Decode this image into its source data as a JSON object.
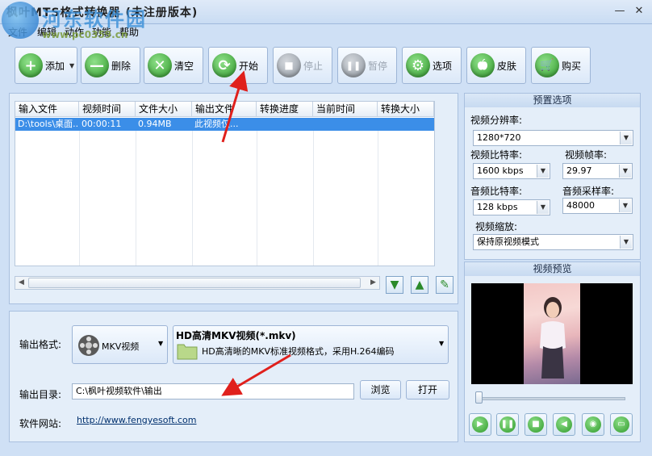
{
  "window": {
    "title": "枫叶MTS格式转换器  (未注册版本)",
    "minimize_glyph": "—",
    "close_glyph": "✕"
  },
  "watermark": {
    "site_name": "河东软件园",
    "url": "www.pc0359.cn"
  },
  "menu": [
    "文件",
    "编辑",
    "动作",
    "功能",
    "帮助"
  ],
  "toolbar": [
    {
      "label": "添加",
      "icon": "plus-icon",
      "glyph": "+",
      "enabled": true,
      "dropdown": true
    },
    {
      "label": "删除",
      "icon": "minus-icon",
      "glyph": "—",
      "enabled": true
    },
    {
      "label": "清空",
      "icon": "clear-icon",
      "glyph": "✕",
      "enabled": true
    },
    {
      "label": "开始",
      "icon": "start-icon",
      "glyph": "⟳",
      "enabled": true
    },
    {
      "label": "停止",
      "icon": "stop-icon",
      "glyph": "■",
      "enabled": false
    },
    {
      "label": "暂停",
      "icon": "pause-icon",
      "glyph": "❚❚",
      "enabled": false
    },
    {
      "label": "选项",
      "icon": "options-icon",
      "glyph": "⚙",
      "enabled": true
    },
    {
      "label": "皮肤",
      "icon": "skin-icon",
      "glyph": "",
      "enabled": true
    },
    {
      "label": "购买",
      "icon": "cart-icon",
      "glyph": "🛒",
      "enabled": true
    }
  ],
  "file_list": {
    "columns": [
      "输入文件",
      "视频时间",
      "文件大小",
      "输出文件",
      "转换进度",
      "当前时间",
      "转换大小"
    ],
    "rows": [
      {
        "input": "D:\\tools\\桌面...",
        "duration": "00:00:11",
        "size": "0.94MB",
        "output": "此视频仅...",
        "progress": "",
        "current": "",
        "converted": ""
      }
    ]
  },
  "list_actions": {
    "down": "▼",
    "up": "▲",
    "edit": "✎"
  },
  "preset": {
    "title": "预置选项",
    "resolution_label": "视频分辨率:",
    "resolution": "1280*720",
    "vbitrate_label": "视频比特率:",
    "vbitrate": "1600 kbps",
    "fps_label": "视频帧率:",
    "fps": "29.97",
    "abitrate_label": "音频比特率:",
    "abitrate": "128 kbps",
    "samplerate_label": "音频采样率:",
    "samplerate": "48000",
    "scale_label": "视频缩放:",
    "scale": "保持原视频模式"
  },
  "preview": {
    "title": "视频预览"
  },
  "output": {
    "format_label": "输出格式:",
    "format_name": "MKV视频",
    "format_title": "HD高清MKV视频(*.mkv)",
    "format_desc": "HD高清晰的MKV标准视频格式，采用H.264编码",
    "dir_label": "输出目录:",
    "dir_value": "C:\\枫叶视频软件\\输出",
    "browse": "浏览",
    "open": "打开",
    "site_label": "软件网站:",
    "site_url": "http://www.fengyesoft.com"
  },
  "colors": {
    "selection": "#3b8ee8",
    "accent_green": "#2f9a2a",
    "arrow_red": "#e0201c"
  }
}
